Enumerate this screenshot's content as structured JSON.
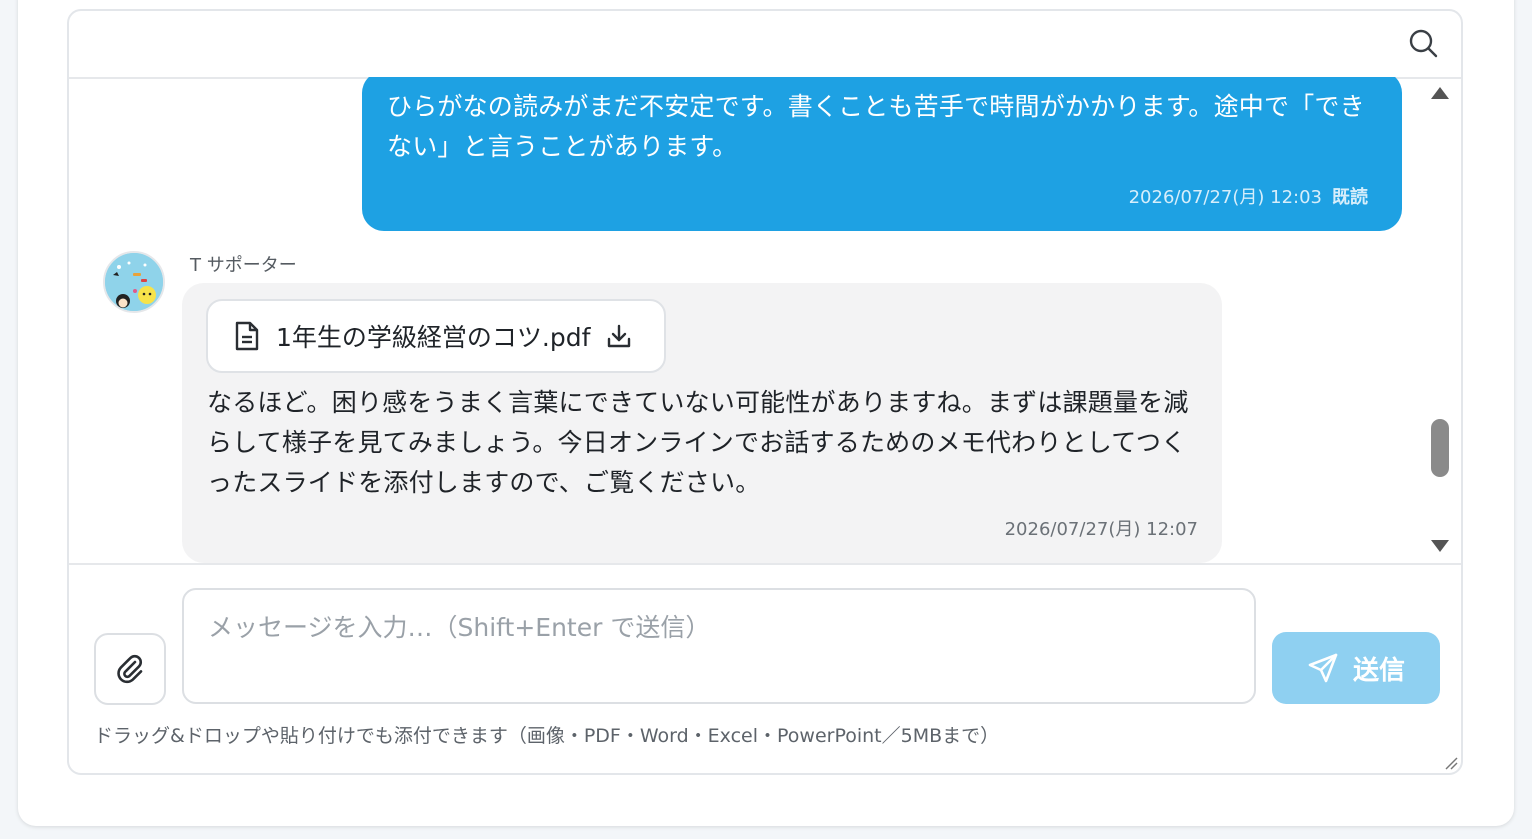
{
  "search": {
    "icon": "search-icon"
  },
  "messages": [
    {
      "direction": "outgoing",
      "text": "ひらがなの読みがまだ不安定です。書くことも苦手で時間がかかります。途中で「できない」と言うことがあります。",
      "timestamp": "2026/07/27(月) 12:03",
      "status": "既読"
    },
    {
      "direction": "incoming",
      "sender": "T サポーター",
      "attachment": {
        "filename": "1年生の学級経営のコツ.pdf",
        "icon": "document-icon",
        "action_icon": "download-icon"
      },
      "text": "なるほど。困り感をうまく言葉にできていない可能性がありますね。まずは課題量を減らして様子を見てみましょう。今日オンラインでお話するためのメモ代わりとしてつくったスライドを添付しますので、ご覧ください。",
      "timestamp": "2026/07/27(月) 12:07"
    }
  ],
  "composer": {
    "placeholder": "メッセージを入力…（Shift+Enter で送信）",
    "value": "",
    "send_label": "送信",
    "hint": "ドラッグ&ドロップや貼り付けでも添付できます（画像・PDF・Word・Excel・PowerPoint／5MBまで）"
  },
  "colors": {
    "outgoing_bubble": "#1ea1e3",
    "incoming_bubble": "#f3f3f4",
    "send_button": "#8fd0f1"
  }
}
